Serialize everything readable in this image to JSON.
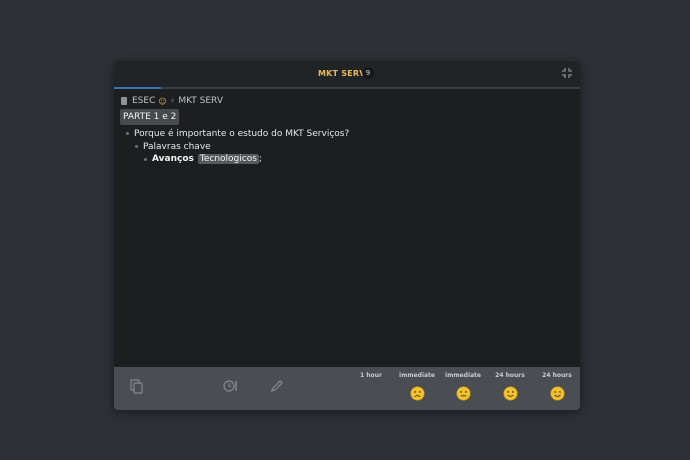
{
  "header": {
    "title": "MKT SERV",
    "badge_count": "9",
    "progress": 0.1
  },
  "breadcrumb": {
    "root": "ESEC",
    "current": "MKT SERV",
    "separator": "›"
  },
  "content": {
    "heading": "PARTE 1 e 2",
    "question": "Porque é importante o estudo do MKT Serviços?",
    "sub_item": "Palavras chave",
    "leaf_bold": "Avanços",
    "leaf_highlight": "Tecnologicos",
    "leaf_tail": ";"
  },
  "footer": {
    "tools": [
      "copy-icon",
      "timer-icon",
      "edit-icon"
    ],
    "ratings": [
      {
        "label": "1 hour",
        "face": "none"
      },
      {
        "label": "immediate",
        "face": "frown"
      },
      {
        "label": "immediate",
        "face": "neutral"
      },
      {
        "label": "24 hours",
        "face": "smile"
      },
      {
        "label": "24 hours",
        "face": "grin"
      }
    ]
  },
  "colors": {
    "accent_title": "#e6b95a",
    "progress_fill": "#3d74b0",
    "face_yellow": "#f2c12e"
  }
}
